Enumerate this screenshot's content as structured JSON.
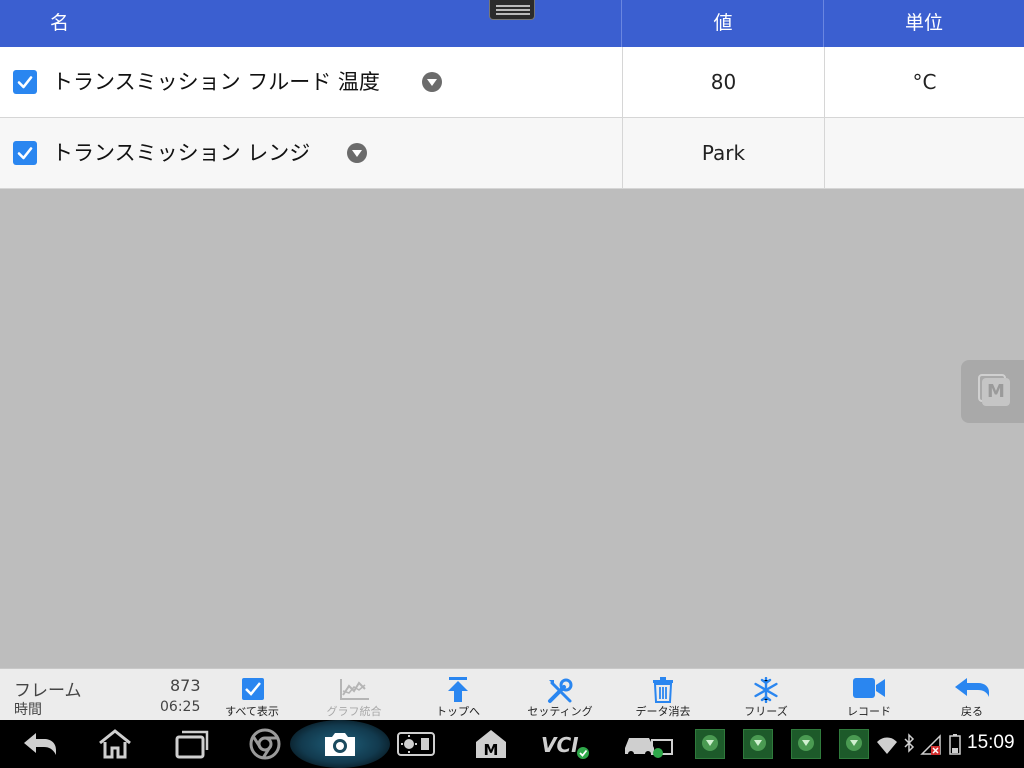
{
  "table": {
    "header": {
      "name": "名",
      "value": "値",
      "unit": "単位"
    },
    "rows": [
      {
        "label": "トランスミッション フルード 温度",
        "checked": true,
        "value": "80",
        "unit": "°C"
      },
      {
        "label": "トランスミッション レンジ",
        "checked": true,
        "value": "Park",
        "unit": ""
      }
    ]
  },
  "floating_button": {
    "icon": "m-app-icon",
    "letter": "M"
  },
  "status": {
    "frame_label": "フレーム",
    "frame_value": "873",
    "time_label": "時間",
    "time_value": "06:25"
  },
  "toolbar": {
    "show_all": "すべて表示",
    "merge_graph": "グラフ統合",
    "to_top": "トップへ",
    "setting": "セッティング",
    "clear_data": "データ消去",
    "freeze": "フリーズ",
    "record": "レコード",
    "back": "戻る"
  },
  "system_bar": {
    "icons": [
      "back-icon",
      "home-icon",
      "recent-apps-icon",
      "chrome-icon",
      "camera-icon",
      "brightness-icon",
      "m-icon",
      "vci-icon",
      "car-icon",
      "download-icon",
      "wifi-icon",
      "bluetooth-icon",
      "signal-icon",
      "battery-icon"
    ],
    "vci_text": "VCI",
    "m_text": "M",
    "clock": "15:09"
  },
  "colors": {
    "header": "#3b5fd0",
    "accent": "#2a86f0",
    "background": "#bdbdbd"
  }
}
